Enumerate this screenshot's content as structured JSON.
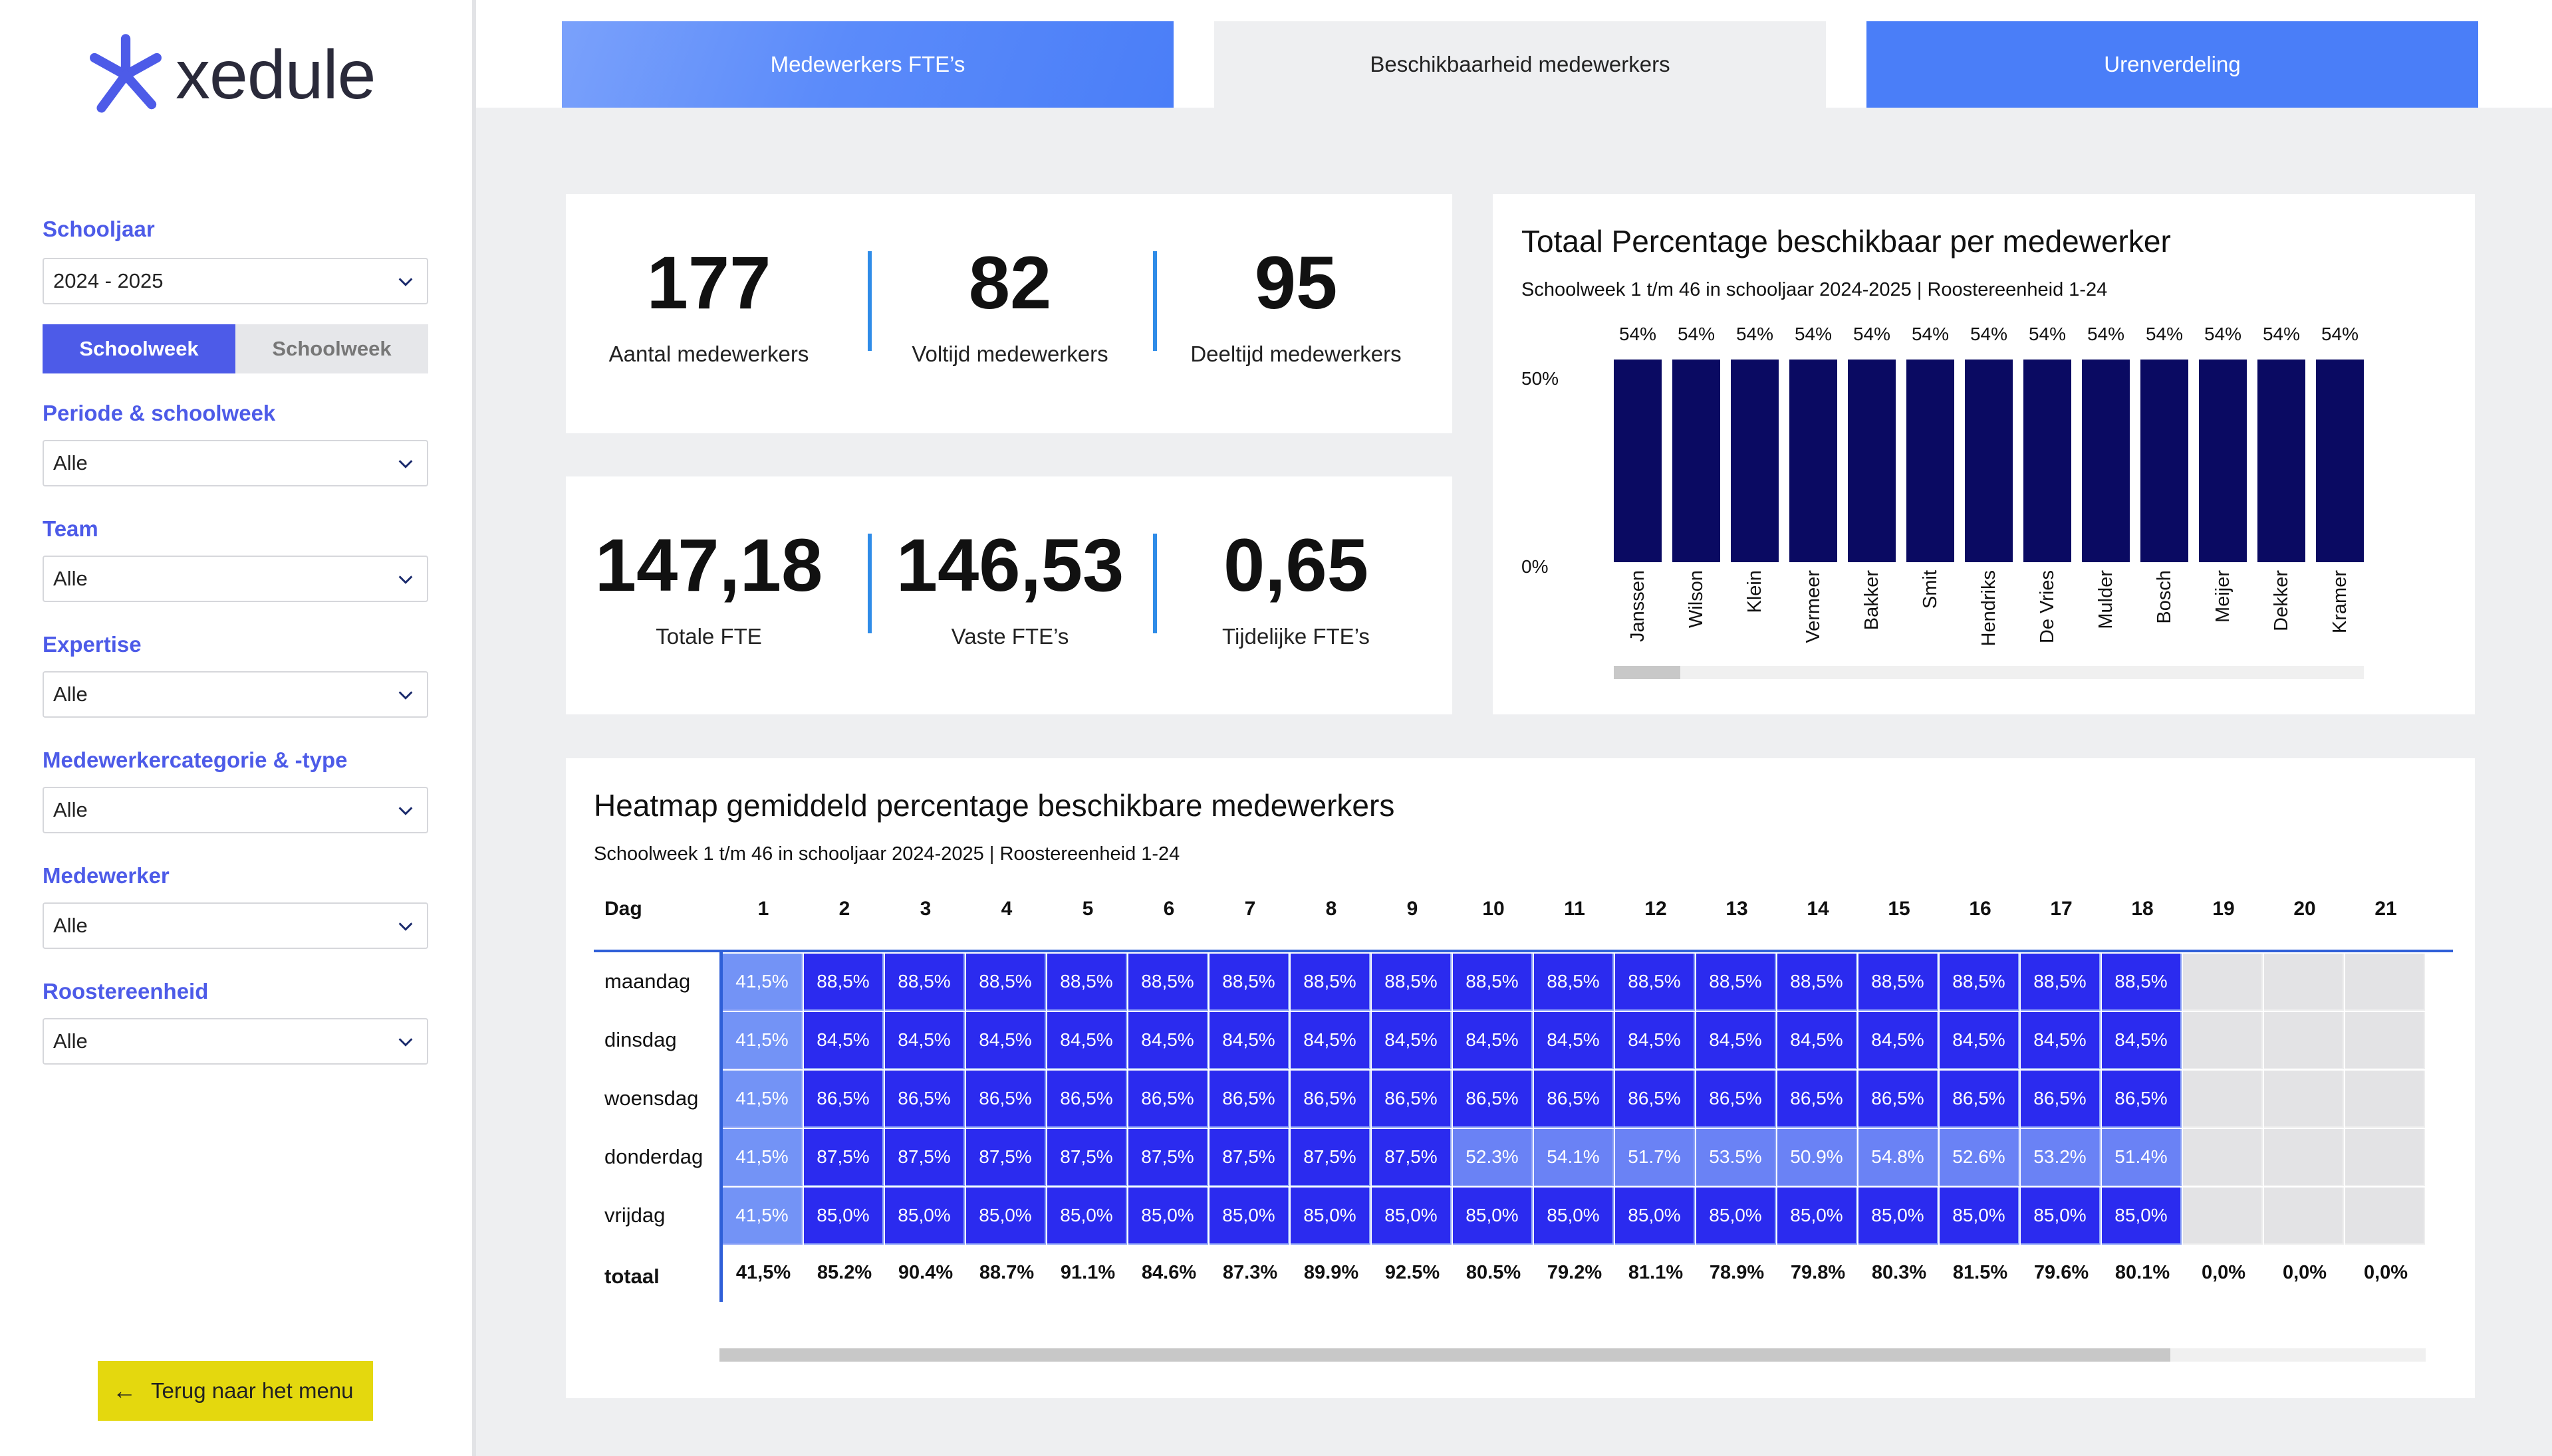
{
  "app": {
    "logo_text": "xedule"
  },
  "sidebar": {
    "schoolyear": {
      "label": "Schooljaar",
      "value": "2024 - 2025"
    },
    "toggle": {
      "active": "Schoolweek",
      "inactive": "Schoolweek"
    },
    "filters": [
      {
        "label": "Periode & schoolweek",
        "value": "Alle"
      },
      {
        "label": "Team",
        "value": "Alle"
      },
      {
        "label": "Expertise",
        "value": "Alle"
      },
      {
        "label": "Medewerkercategorie & -type",
        "value": "Alle"
      },
      {
        "label": "Medewerker",
        "value": "Alle"
      },
      {
        "label": "Roostereenheid",
        "value": "Alle"
      }
    ],
    "back_button": "Terug naar het menu",
    "accent_color": "#4d5be8",
    "back_button_color": "#e4d80e"
  },
  "tabs": [
    {
      "label": "Medewerkers FTE’s",
      "state": "inactive"
    },
    {
      "label": "Beschikbaarheid medewerkers",
      "state": "active"
    },
    {
      "label": "Urenverdeling",
      "state": "inactive"
    }
  ],
  "kpis_top": [
    {
      "value": "177",
      "label": "Aantal medewerkers"
    },
    {
      "value": "82",
      "label": "Voltijd medewerkers"
    },
    {
      "value": "95",
      "label": "Deeltijd medewerkers"
    }
  ],
  "kpis_bottom": [
    {
      "value": "147,18",
      "label": "Totale FTE"
    },
    {
      "value": "146,53",
      "label": "Vaste FTE’s"
    },
    {
      "value": "0,65",
      "label": "Tijdelijke FTE’s"
    }
  ],
  "bar_chart": {
    "title": "Totaal Percentage beschikbaar per medewerker",
    "subtitle": "Schoolweek 1 t/m 46 in schooljaar 2024-2025 | Roostereenheid 1-24",
    "y_ticks": [
      "50%",
      "0%"
    ]
  },
  "heatmap": {
    "title": "Heatmap gemiddeld percentage beschikbare medewerkers",
    "subtitle": "Schoolweek 1 t/m 46 in schooljaar 2024-2025 | Roostereenheid 1-24",
    "day_header": "Dag",
    "total_label": "totaal"
  },
  "chart_data": [
    {
      "type": "bar",
      "categories": [
        "Janssen",
        "Wilson",
        "Klein",
        "Vermeer",
        "Bakker",
        "Smit",
        "Hendriks",
        "De Vries",
        "Mulder",
        "Bosch",
        "Meijer",
        "Dekker",
        "Kramer"
      ],
      "values": [
        54,
        54,
        54,
        54,
        54,
        54,
        54,
        54,
        54,
        54,
        54,
        54,
        54
      ],
      "value_labels": [
        "54%",
        "54%",
        "54%",
        "54%",
        "54%",
        "54%",
        "54%",
        "54%",
        "54%",
        "54%",
        "54%",
        "54%",
        "54%"
      ],
      "ylim": [
        0,
        54
      ],
      "bar_color": "#0a0a62",
      "grid": false
    },
    {
      "type": "heatmap",
      "columns": [
        "1",
        "2",
        "3",
        "4",
        "5",
        "6",
        "7",
        "8",
        "9",
        "10",
        "11",
        "12",
        "13",
        "14",
        "15",
        "16",
        "17",
        "18",
        "19",
        "20",
        "21"
      ],
      "rows": [
        {
          "day": "maandag",
          "values": [
            "41,5%",
            "88,5%",
            "88,5%",
            "88,5%",
            "88,5%",
            "88,5%",
            "88,5%",
            "88,5%",
            "88,5%",
            "88,5%",
            "88,5%",
            "88,5%",
            "88,5%",
            "88,5%",
            "88,5%",
            "88,5%",
            "88,5%",
            "88,5%",
            null,
            null,
            null
          ],
          "num": [
            41.5,
            88.5,
            88.5,
            88.5,
            88.5,
            88.5,
            88.5,
            88.5,
            88.5,
            88.5,
            88.5,
            88.5,
            88.5,
            88.5,
            88.5,
            88.5,
            88.5,
            88.5,
            null,
            null,
            null
          ]
        },
        {
          "day": "dinsdag",
          "values": [
            "41,5%",
            "84,5%",
            "84,5%",
            "84,5%",
            "84,5%",
            "84,5%",
            "84,5%",
            "84,5%",
            "84,5%",
            "84,5%",
            "84,5%",
            "84,5%",
            "84,5%",
            "84,5%",
            "84,5%",
            "84,5%",
            "84,5%",
            "84,5%",
            null,
            null,
            null
          ],
          "num": [
            41.5,
            84.5,
            84.5,
            84.5,
            84.5,
            84.5,
            84.5,
            84.5,
            84.5,
            84.5,
            84.5,
            84.5,
            84.5,
            84.5,
            84.5,
            84.5,
            84.5,
            84.5,
            null,
            null,
            null
          ]
        },
        {
          "day": "woensdag",
          "values": [
            "41,5%",
            "86,5%",
            "86,5%",
            "86,5%",
            "86,5%",
            "86,5%",
            "86,5%",
            "86,5%",
            "86,5%",
            "86,5%",
            "86,5%",
            "86,5%",
            "86,5%",
            "86,5%",
            "86,5%",
            "86,5%",
            "86,5%",
            "86,5%",
            null,
            null,
            null
          ],
          "num": [
            41.5,
            86.5,
            86.5,
            86.5,
            86.5,
            86.5,
            86.5,
            86.5,
            86.5,
            86.5,
            86.5,
            86.5,
            86.5,
            86.5,
            86.5,
            86.5,
            86.5,
            86.5,
            null,
            null,
            null
          ]
        },
        {
          "day": "donderdag",
          "values": [
            "41,5%",
            "87,5%",
            "87,5%",
            "87,5%",
            "87,5%",
            "87,5%",
            "87,5%",
            "87,5%",
            "87,5%",
            "52.3%",
            "54.1%",
            "51.7%",
            "53.5%",
            "50.9%",
            "54.8%",
            "52.6%",
            "53.2%",
            "51.4%",
            null,
            null,
            null
          ],
          "num": [
            41.5,
            87.5,
            87.5,
            87.5,
            87.5,
            87.5,
            87.5,
            87.5,
            87.5,
            52.3,
            54.1,
            51.7,
            53.5,
            50.9,
            54.8,
            52.6,
            53.2,
            51.4,
            null,
            null,
            null
          ]
        },
        {
          "day": "vrijdag",
          "values": [
            "41,5%",
            "85,0%",
            "85,0%",
            "85,0%",
            "85,0%",
            "85,0%",
            "85,0%",
            "85,0%",
            "85,0%",
            "85,0%",
            "85,0%",
            "85,0%",
            "85,0%",
            "85,0%",
            "85,0%",
            "85,0%",
            "85,0%",
            "85,0%",
            null,
            null,
            null
          ],
          "num": [
            41.5,
            85.0,
            85.0,
            85.0,
            85.0,
            85.0,
            85.0,
            85.0,
            85.0,
            85.0,
            85.0,
            85.0,
            85.0,
            85.0,
            85.0,
            85.0,
            85.0,
            85.0,
            null,
            null,
            null
          ]
        }
      ],
      "totals": [
        "41,5%",
        "85.2%",
        "90.4%",
        "88.7%",
        "91.1%",
        "84.6%",
        "87.3%",
        "89.9%",
        "92.5%",
        "80.5%",
        "79.2%",
        "81.1%",
        "78.9%",
        "79.8%",
        "80.3%",
        "81.5%",
        "79.6%",
        "80.1%",
        "0,0%",
        "0,0%",
        "0,0%"
      ],
      "colors": {
        "high": "#2b2bef",
        "mid": "#6a82f5",
        "low": "#7393f6",
        "empty": "#e3e3e5"
      }
    }
  ]
}
